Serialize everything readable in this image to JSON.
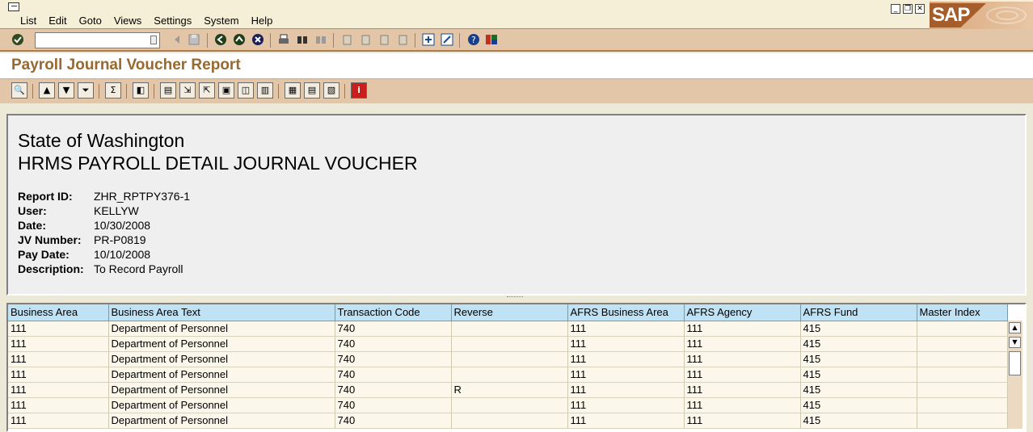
{
  "menubar": {
    "items": [
      {
        "label": "List"
      },
      {
        "label": "Edit"
      },
      {
        "label": "Goto"
      },
      {
        "label": "Views"
      },
      {
        "label": "Settings"
      },
      {
        "label": "System"
      },
      {
        "label": "Help"
      }
    ],
    "logo_text": "SAP"
  },
  "toolbar": {
    "command_field": {
      "value": "",
      "placeholder": ""
    }
  },
  "title": "Payroll Journal Voucher Report",
  "report_header": {
    "org": "State of Washington",
    "heading": "HRMS PAYROLL DETAIL JOURNAL VOUCHER",
    "fields": [
      {
        "label": "Report ID:",
        "value": "ZHR_RPTPY376-1"
      },
      {
        "label": "User:",
        "value": "KELLYW"
      },
      {
        "label": "Date:",
        "value": "10/30/2008"
      },
      {
        "label": "JV Number:",
        "value": "PR-P0819"
      },
      {
        "label": "Pay Date:",
        "value": "10/10/2008"
      },
      {
        "label": "Description:",
        "value": "To Record Payroll"
      }
    ]
  },
  "table": {
    "columns": [
      "Business Area",
      "Business Area Text",
      "Transaction Code",
      "Reverse",
      "AFRS Business Area",
      "AFRS Agency",
      "AFRS Fund",
      "Master Index"
    ],
    "rows": [
      [
        "111",
        "Department of Personnel",
        "740",
        "",
        "111",
        "111",
        "415",
        ""
      ],
      [
        "111",
        "Department of Personnel",
        "740",
        "",
        "111",
        "111",
        "415",
        ""
      ],
      [
        "111",
        "Department of Personnel",
        "740",
        "",
        "111",
        "111",
        "415",
        ""
      ],
      [
        "111",
        "Department of Personnel",
        "740",
        "",
        "111",
        "111",
        "415",
        ""
      ],
      [
        "111",
        "Department of Personnel",
        "740",
        "R",
        "111",
        "111",
        "415",
        ""
      ],
      [
        "111",
        "Department of Personnel",
        "740",
        "",
        "111",
        "111",
        "415",
        ""
      ],
      [
        "111",
        "Department of Personnel",
        "740",
        "",
        "111",
        "111",
        "415",
        ""
      ]
    ]
  },
  "colors": {
    "title": "#99682e",
    "toolbar": "#e3c6a8",
    "table_header": "#bfe3f4",
    "table_row": "#fbf7ea"
  }
}
